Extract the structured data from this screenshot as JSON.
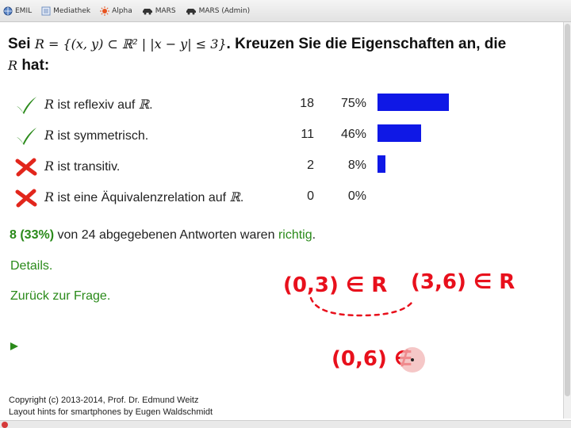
{
  "bookmarks": [
    {
      "label": "EMIL",
      "icon": "globe-icon"
    },
    {
      "label": "Mediathek",
      "icon": "list-icon"
    },
    {
      "label": "Alpha",
      "icon": "sun-icon"
    },
    {
      "label": "MARS",
      "icon": "car-icon"
    },
    {
      "label": "MARS (Admin)",
      "icon": "car-icon"
    }
  ],
  "question": {
    "prefix": "Sei",
    "relation": "R = {(x, y) ⊂ ℝ² | |x − y| ≤ 3}",
    "text": ". Kreuzen Sie die Eigenschaften an, die",
    "relation_var": "R",
    "suffix": "hat:"
  },
  "answers": [
    {
      "symbol": "R",
      "text": "ist reflexiv auf",
      "set": "ℝ",
      "end": ".",
      "correct": true,
      "count": 18,
      "percent": "75%",
      "fraction": 0.75
    },
    {
      "symbol": "R",
      "text": "ist symmetrisch.",
      "set": "",
      "end": "",
      "correct": true,
      "count": 11,
      "percent": "46%",
      "fraction": 0.46
    },
    {
      "symbol": "R",
      "text": "ist transitiv.",
      "set": "",
      "end": "",
      "correct": false,
      "count": 2,
      "percent": "8%",
      "fraction": 0.08
    },
    {
      "symbol": "R",
      "text": "ist eine Äquivalenzrelation auf",
      "set": "ℝ",
      "end": ".",
      "correct": false,
      "count": 0,
      "percent": "0%",
      "fraction": 0.0
    }
  ],
  "summary": {
    "correct": "8 (33%)",
    "mid": "von 24 abgegebenen Antworten waren",
    "word": "richtig",
    "end": "."
  },
  "links": {
    "details": "Details.",
    "back": "Zurück zur Frage."
  },
  "footer": {
    "line1": "Copyright (c) 2013-2014, Prof. Dr. Edmund Weitz",
    "line2": "Layout hints for smartphones by Eugen Waldschmidt"
  },
  "annotations": {
    "left": "(0,3) ∈ R",
    "right": "(3,6) ∈ R",
    "bottom": "(0,6) ∉"
  },
  "colors": {
    "bar": "#0f18e6",
    "check": "#2a8a1a",
    "cross": "#e2261c",
    "link": "#2a8a1a",
    "annotation": "#e8101c"
  }
}
